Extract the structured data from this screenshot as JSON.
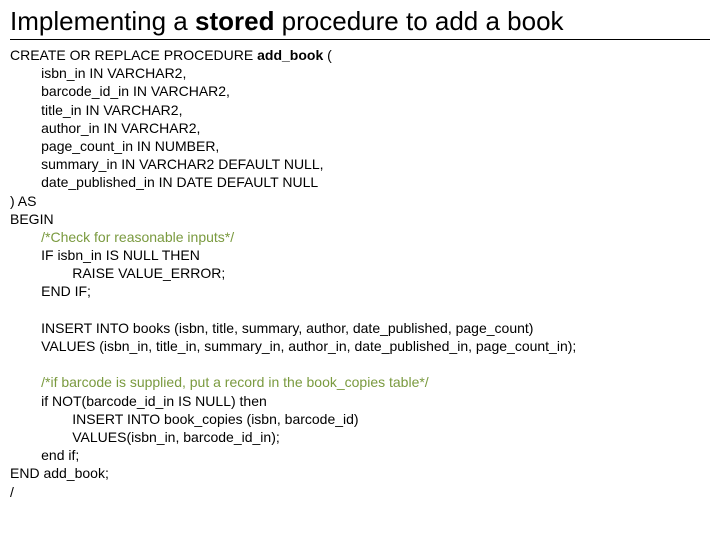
{
  "title": {
    "t1": "Implementing a ",
    "t2": "stored",
    "t3": " procedure to add a book"
  },
  "code": {
    "l1a": "CREATE OR REPLACE PROCEDURE ",
    "l1b": "add_book",
    "l1c": " (",
    "l2": "        isbn_in IN VARCHAR2,",
    "l3": "        barcode_id_in IN VARCHAR2,",
    "l4": "        title_in IN VARCHAR2,",
    "l5": "        author_in IN VARCHAR2,",
    "l6": "        page_count_in IN NUMBER,",
    "l7": "        summary_in IN VARCHAR2 DEFAULT NULL,",
    "l8": "        date_published_in IN DATE DEFAULT NULL",
    "l9": ") AS",
    "l10": "BEGIN",
    "l11": "        /*Check for reasonable inputs*/",
    "l12": "        IF isbn_in IS NULL THEN",
    "l13": "                RAISE VALUE_ERROR;",
    "l14": "        END IF;",
    "blank1": "",
    "l15": "        INSERT INTO books (isbn, title, summary, author, date_published, page_count)",
    "l16": "        VALUES (isbn_in, title_in, summary_in, author_in, date_published_in, page_count_in);",
    "blank2": "",
    "l17": "        /*if barcode is supplied, put a record in the book_copies table*/",
    "l18": "        if NOT(barcode_id_in IS NULL) then",
    "l19": "                INSERT INTO book_copies (isbn, barcode_id)",
    "l20": "                VALUES(isbn_in, barcode_id_in);",
    "l21": "        end if;",
    "l22": "END add_book;",
    "l23": "/"
  }
}
